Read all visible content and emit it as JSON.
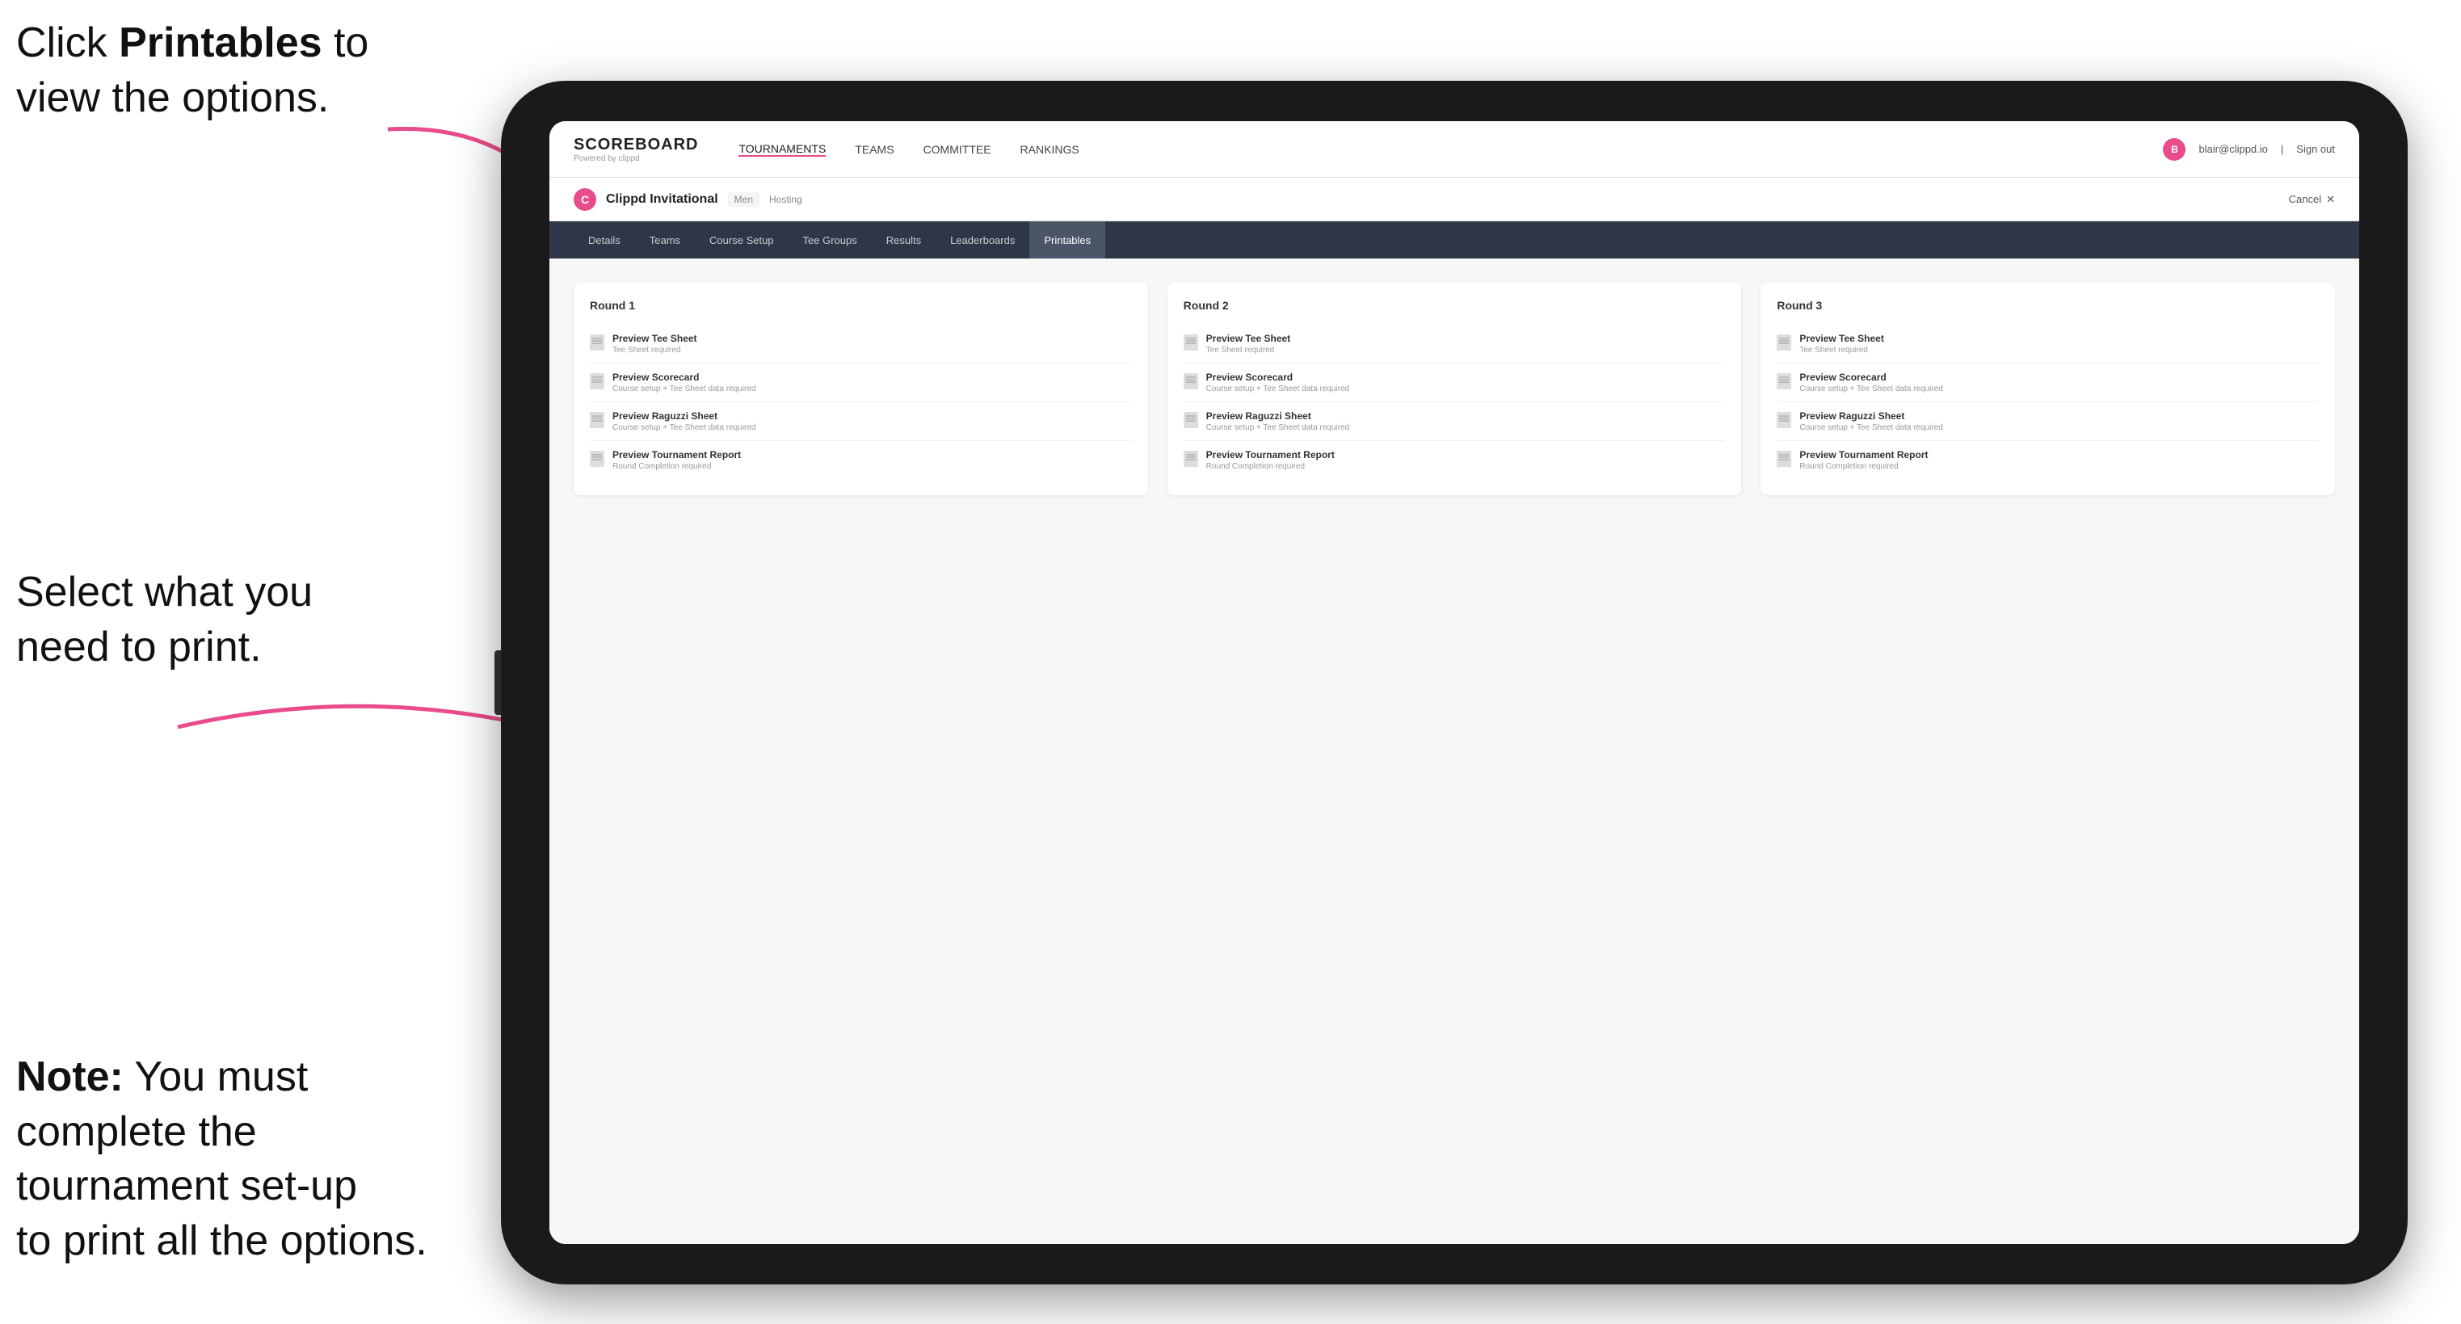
{
  "annotations": {
    "top": {
      "line1": "Click ",
      "bold": "Printables",
      "line2": " to",
      "line3": "view the options."
    },
    "middle": {
      "line1": "Select what you",
      "line2": "need to print."
    },
    "bottom": {
      "bold": "Note:",
      "text": " You must complete the tournament set-up to print all the options."
    }
  },
  "nav": {
    "logo": "SCOREBOARD",
    "powered_by": "Powered by clippd",
    "links": [
      "TOURNAMENTS",
      "TEAMS",
      "COMMITTEE",
      "RANKINGS"
    ],
    "user_email": "blair@clippd.io",
    "sign_out": "Sign out"
  },
  "tournament": {
    "name": "Clippd Invitational",
    "meta": "Men",
    "hosting": "Hosting",
    "cancel": "Cancel"
  },
  "sub_tabs": [
    "Details",
    "Teams",
    "Course Setup",
    "Tee Groups",
    "Results",
    "Leaderboards",
    "Printables"
  ],
  "active_tab": "Printables",
  "rounds": [
    {
      "title": "Round 1",
      "items": [
        {
          "title": "Preview Tee Sheet",
          "subtitle": "Tee Sheet required"
        },
        {
          "title": "Preview Scorecard",
          "subtitle": "Course setup + Tee Sheet data required"
        },
        {
          "title": "Preview Raguzzi Sheet",
          "subtitle": "Course setup + Tee Sheet data required"
        },
        {
          "title": "Preview Tournament Report",
          "subtitle": "Round Completion required"
        }
      ]
    },
    {
      "title": "Round 2",
      "items": [
        {
          "title": "Preview Tee Sheet",
          "subtitle": "Tee Sheet required"
        },
        {
          "title": "Preview Scorecard",
          "subtitle": "Course setup + Tee Sheet data required"
        },
        {
          "title": "Preview Raguzzi Sheet",
          "subtitle": "Course setup + Tee Sheet data required"
        },
        {
          "title": "Preview Tournament Report",
          "subtitle": "Round Completion required"
        }
      ]
    },
    {
      "title": "Round 3",
      "items": [
        {
          "title": "Preview Tee Sheet",
          "subtitle": "Tee Sheet required"
        },
        {
          "title": "Preview Scorecard",
          "subtitle": "Course setup + Tee Sheet data required"
        },
        {
          "title": "Preview Raguzzi Sheet",
          "subtitle": "Course setup + Tee Sheet data required"
        },
        {
          "title": "Preview Tournament Report",
          "subtitle": "Round Completion required"
        }
      ]
    }
  ]
}
